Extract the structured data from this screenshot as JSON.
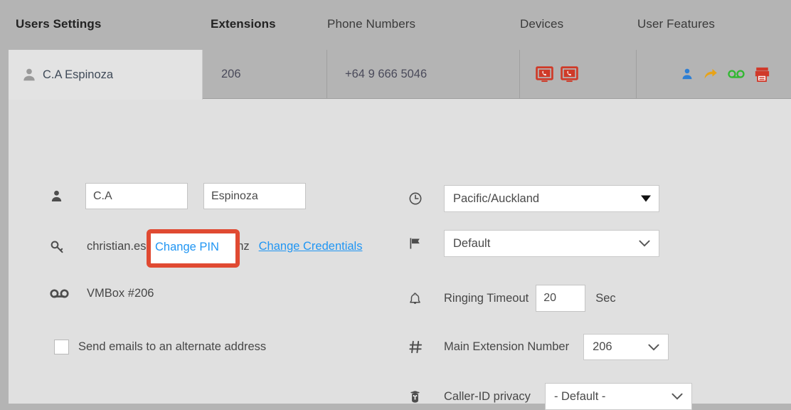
{
  "topnav": {
    "items": [
      {
        "label": "Users Settings",
        "bold": true
      },
      {
        "label": "Extensions",
        "bold": true
      },
      {
        "label": "Phone Numbers",
        "bold": false
      },
      {
        "label": "Devices",
        "bold": false
      },
      {
        "label": "User Features",
        "bold": false
      }
    ]
  },
  "summary_row": {
    "user_name": "C.A Espinoza",
    "extension": "206",
    "phone_number": "+64 9 666 5046",
    "device_icons": [
      "desk-phone-icon",
      "desk-phone-icon"
    ],
    "feature_icons": [
      "user-icon",
      "call-forward-icon",
      "voicemail-icon",
      "fax-icon"
    ]
  },
  "form": {
    "first_name": "C.A",
    "last_name": "Espinoza",
    "email": "christian.espinoza@voyager.nz",
    "change_credentials_label": "Change Credentials",
    "vmbox_label": "VMBox #206",
    "change_pin_label": "Change PIN",
    "alternate_email_checkbox_label": "Send emails to an alternate address",
    "timezone_value": "Pacific/Auckland",
    "language_value": "Default",
    "ringing_timeout_label": "Ringing Timeout",
    "ringing_timeout_value": "20",
    "ringing_timeout_unit": "Sec",
    "main_extension_label": "Main Extension Number",
    "main_extension_value": "206",
    "caller_id_privacy_label": "Caller-ID privacy",
    "caller_id_privacy_value": "- Default -"
  },
  "colors": {
    "page_background": "#b4b4b4",
    "panel_background": "#e0e0e0",
    "active_cell": "#e3e3e3",
    "link_blue": "#2196f3",
    "annotation_red": "#e04a32",
    "device_icon_red": "#cf3a28",
    "feature_user_blue": "#2e7fd4",
    "feature_forward_amber": "#e8a317",
    "feature_voicemail_green": "#2fb82f",
    "feature_fax_red": "#d0392a"
  },
  "annotation": {
    "target": "change-pin-link",
    "shape": "rounded-rectangle",
    "color": "#e04a32"
  }
}
